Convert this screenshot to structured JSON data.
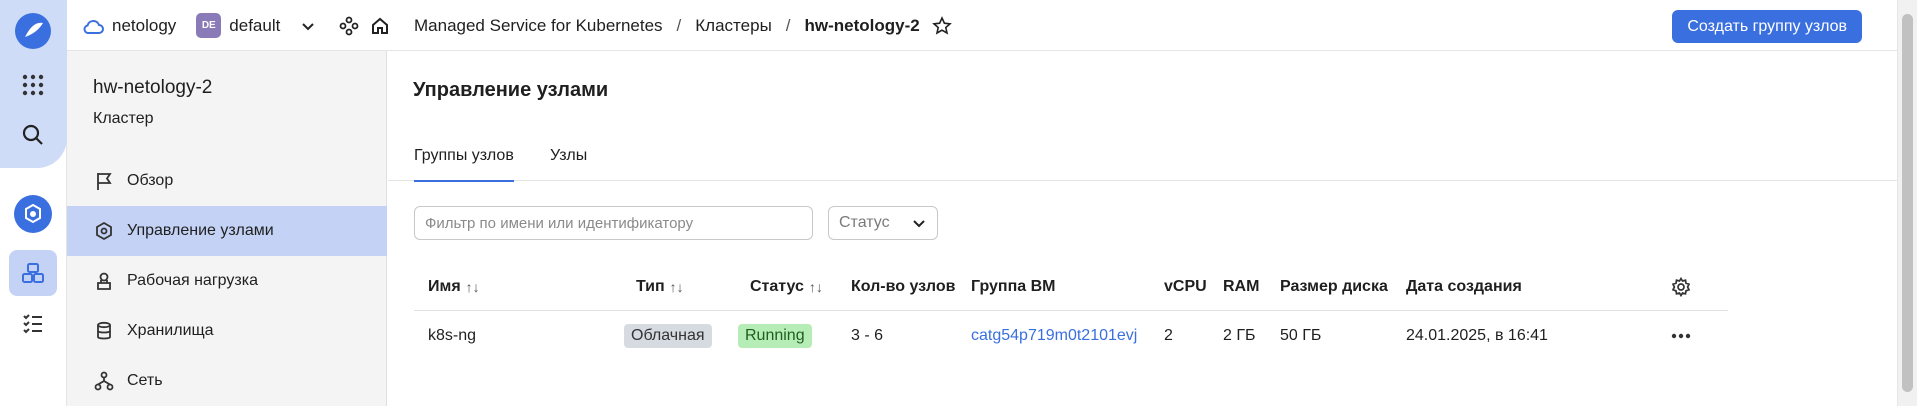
{
  "header": {
    "cloud": "netology",
    "folder_badge": "DE",
    "folder": "default",
    "breadcrumb": [
      "Managed Service for Kubernetes",
      "Кластеры",
      "hw-netology-2"
    ],
    "create_button": "Создать группу узлов"
  },
  "sidebar": {
    "title": "hw-netology-2",
    "subtitle": "Кластер",
    "items": [
      {
        "label": "Обзор",
        "icon": "flag-icon"
      },
      {
        "label": "Управление узлами",
        "icon": "node-management-icon",
        "active": true
      },
      {
        "label": "Рабочая нагрузка",
        "icon": "workload-icon"
      },
      {
        "label": "Хранилища",
        "icon": "database-icon"
      },
      {
        "label": "Сеть",
        "icon": "network-icon"
      }
    ]
  },
  "main": {
    "title": "Управление узлами",
    "tabs": [
      {
        "label": "Группы узлов",
        "active": true
      },
      {
        "label": "Узлы",
        "active": false
      }
    ],
    "filter_placeholder": "Фильтр по имени или идентификатору",
    "status_filter": "Статус",
    "table": {
      "headers": {
        "name": "Имя",
        "type": "Тип",
        "status": "Статус",
        "count": "Кол-во узлов",
        "vm_group": "Группа ВМ",
        "vcpu": "vCPU",
        "ram": "RAM",
        "disk": "Размер диска",
        "created": "Дата создания"
      },
      "rows": [
        {
          "name": "k8s-ng",
          "type": "Облачная",
          "status": "Running",
          "count": "3 - 6",
          "vm_group": "catg54p719m0t2101evj",
          "vcpu": "2",
          "ram": "2 ГБ",
          "disk": "50 ГБ",
          "created": "24.01.2025, в 16:41"
        }
      ]
    }
  },
  "colors": {
    "accent": "#3a6fe0",
    "active_bg": "#c4d3f5",
    "status_running_bg": "#b6ecb6",
    "type_bg": "#d6dbe2"
  }
}
